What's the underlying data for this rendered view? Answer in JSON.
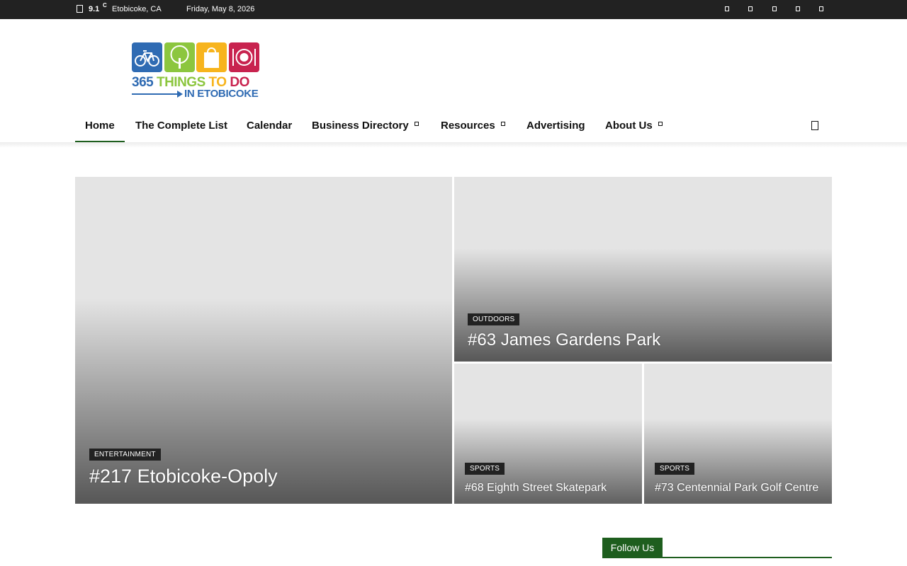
{
  "topbar": {
    "temperature": "9.1",
    "unit": "C",
    "location": "Etobicoke, CA",
    "date": "Friday, May 8, 2026",
    "weather_icon": "weather-icon",
    "social_icons": [
      "facebook-icon",
      "instagram-icon",
      "twitter-icon",
      "youtube-icon",
      "rss-icon"
    ]
  },
  "logo": {
    "number": "365",
    "things": "THINGS",
    "to": "TO",
    "do": "DO",
    "line2": "IN ETOBICOKE",
    "icons": [
      "bicycle-icon",
      "tree-icon",
      "shopping-bag-icon",
      "dining-plate-icon"
    ],
    "colors": [
      "#2f6bb3",
      "#8cc63f",
      "#f7b41d",
      "#c8234f"
    ]
  },
  "nav": {
    "items": [
      {
        "label": "Home",
        "active": true
      },
      {
        "label": "The Complete List"
      },
      {
        "label": "Calendar"
      },
      {
        "label": "Business Directory",
        "dropdown": true
      },
      {
        "label": "Resources",
        "dropdown": true
      },
      {
        "label": "Advertising"
      },
      {
        "label": "About Us",
        "dropdown": true
      }
    ],
    "search_icon": "search-icon",
    "accent": "#1e5e1e"
  },
  "featured": [
    {
      "category": "ENTERTAINMENT",
      "title": "#217 Etobicoke-Opoly"
    },
    {
      "category": "OUTDOORS",
      "title": "#63 James Gardens Park"
    },
    {
      "category": "SPORTS",
      "title": "#68 Eighth Street Skatepark"
    },
    {
      "category": "SPORTS",
      "title": "#73 Centennial Park Golf Centre"
    }
  ],
  "sidebar": {
    "follow_us": "Follow Us"
  }
}
